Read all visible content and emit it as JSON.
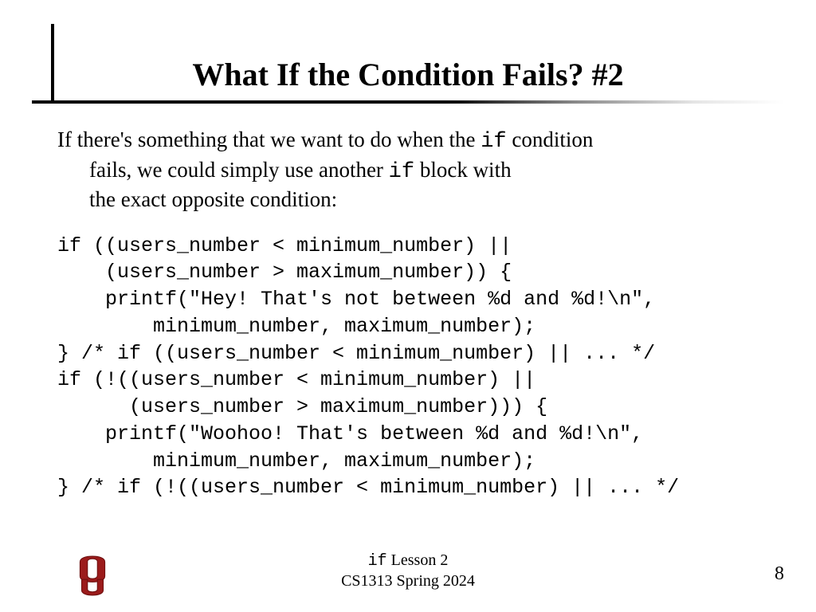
{
  "title": "What If the Condition Fails? #2",
  "para": {
    "l1a": "If there's something that we want to do when the ",
    "l1kw": "if",
    "l1b": " condition",
    "l2a": "fails, we could simply use another ",
    "l2kw": "if",
    "l2b": " block with",
    "l3": "the exact opposite condition:"
  },
  "code": "if ((users_number < minimum_number) ||\n    (users_number > maximum_number)) {\n    printf(\"Hey! That's not between %d and %d!\\n\",\n        minimum_number, maximum_number);\n} /* if ((users_number < minimum_number) || ... */\nif (!((users_number < minimum_number) ||\n      (users_number > maximum_number))) {\n    printf(\"Woohoo! That's between %d and %d!\\n\",\n        minimum_number, maximum_number);\n} /* if (!((users_number < minimum_number) || ... */",
  "footer": {
    "lesson_kw": "if",
    "lesson_rest": " Lesson 2",
    "course": "CS1313 Spring 2024",
    "page": "8"
  }
}
